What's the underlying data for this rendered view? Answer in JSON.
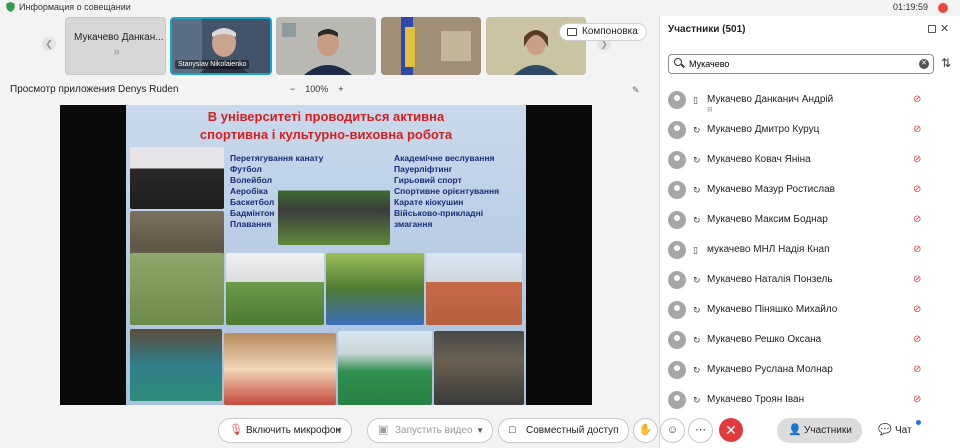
{
  "topbar": {
    "info_label": "Информация о совещании",
    "timer": "01:19:59"
  },
  "strip": {
    "self_name": "Мукачево Данкан...",
    "self_sub": "Я",
    "active_speaker": "Stanyslav Nikolaienko",
    "layout_button": "Компоновка"
  },
  "share": {
    "viewing_label": "Просмотр приложения",
    "presenter": "Denys Ruden",
    "zoom_minus": "−",
    "zoom_value": "100%",
    "zoom_plus": "+"
  },
  "slide": {
    "title_line1": "В університеті проводиться активна",
    "title_line2": "спортивна і культурно-виховна робота",
    "left_list": [
      "Перетягування канату",
      "Футбол",
      "Волейбол",
      "Аеробіка",
      "Баскетбол",
      "Бадмінтон",
      "Плавання"
    ],
    "right_list": [
      "Академічне веслування",
      "Пауерліфтинг",
      "Гирьовий спорт",
      "Спортивне орієнтування",
      "Карате кіокушин",
      "Військово-прикладні",
      "змагання"
    ]
  },
  "panel": {
    "title": "Участники (501)",
    "search_value": "Мукачево",
    "participants": [
      {
        "name": "Мукачево Данканич Андрій",
        "sub": "Я",
        "device": "phone"
      },
      {
        "name": "Мукачево Дмитро Куруц",
        "sub": "",
        "device": "sync"
      },
      {
        "name": "Мукачево Ковач Яніна",
        "sub": "",
        "device": "sync"
      },
      {
        "name": "Мукачево Мазур Ростислав",
        "sub": "",
        "device": "sync"
      },
      {
        "name": "Мукачево Максим Боднар",
        "sub": "",
        "device": "sync"
      },
      {
        "name": "мукачево МНЛ Надія Кнап",
        "sub": "",
        "device": "phone"
      },
      {
        "name": "Мукачево Наталія Понзель",
        "sub": "",
        "device": "sync"
      },
      {
        "name": "Мукачево Піняшко Михайло",
        "sub": "",
        "device": "sync"
      },
      {
        "name": "Мукачево Решко Оксана",
        "sub": "",
        "device": "sync"
      },
      {
        "name": "Мукачево Руслана Молнар",
        "sub": "",
        "device": "sync"
      },
      {
        "name": "Мукачево Троян Іван",
        "sub": "",
        "device": "sync"
      }
    ]
  },
  "bottombar": {
    "mic_label": "Включить микрофон",
    "video_label": "Запустить видео",
    "share_label": "Совместный доступ",
    "participants_label": "Участники",
    "chat_label": "Чат"
  },
  "colors": {
    "accent": "#19a7c9",
    "end_call": "#e03a3a",
    "muted_mic": "#dd4444",
    "slide_title": "#d42020",
    "slide_text": "#1a2c78"
  }
}
